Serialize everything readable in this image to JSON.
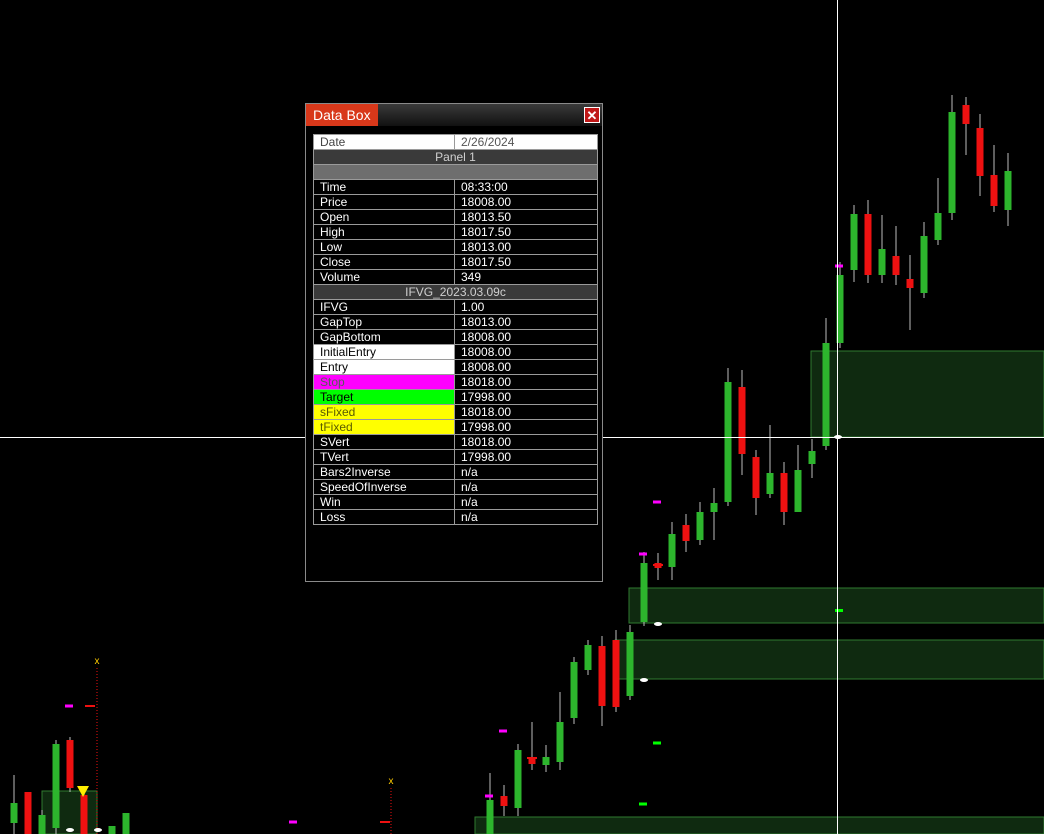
{
  "databox": {
    "title": "Data Box",
    "close_symbol": "✕",
    "date_label": "Date",
    "date_value": "2/26/2024",
    "panel_label": "Panel 1",
    "indicator_label": "IFVG_2023.03.09c",
    "rows_top": [
      {
        "label": "Time",
        "value": "08:33:00"
      },
      {
        "label": "Price",
        "value": "18008.00"
      },
      {
        "label": "Open",
        "value": "18013.50"
      },
      {
        "label": "High",
        "value": "18017.50"
      },
      {
        "label": "Low",
        "value": "18013.00"
      },
      {
        "label": "Close",
        "value": "18017.50"
      },
      {
        "label": "Volume",
        "value": "349"
      }
    ],
    "rows_indicator": [
      {
        "label": "IFVG",
        "value": "1.00",
        "bg": "#000000",
        "fg": "#ffffff"
      },
      {
        "label": "GapTop",
        "value": "18013.00",
        "bg": "#000000",
        "fg": "#ffffff"
      },
      {
        "label": "GapBottom",
        "value": "18008.00",
        "bg": "#000000",
        "fg": "#ffffff"
      },
      {
        "label": "InitialEntry",
        "value": "18008.00",
        "bg": "#ffffff",
        "fg": "#000000"
      },
      {
        "label": "Entry",
        "value": "18008.00",
        "bg": "#ffffff",
        "fg": "#000000"
      },
      {
        "label": "Stop",
        "value": "18018.00",
        "bg": "#ff00ff",
        "fg": "#5a5a5a"
      },
      {
        "label": "Target",
        "value": "17998.00",
        "bg": "#00ff00",
        "fg": "#000000"
      },
      {
        "label": "sFixed",
        "value": "18018.00",
        "bg": "#ffff00",
        "fg": "#5a5a00"
      },
      {
        "label": "tFixed",
        "value": "17998.00",
        "bg": "#ffff00",
        "fg": "#5a5a00"
      },
      {
        "label": "SVert",
        "value": "18018.00",
        "bg": "#000000",
        "fg": "#ffffff"
      },
      {
        "label": "TVert",
        "value": "17998.00",
        "bg": "#000000",
        "fg": "#ffffff"
      },
      {
        "label": "Bars2Inverse",
        "value": "n/a",
        "bg": "#000000",
        "fg": "#ffffff"
      },
      {
        "label": "SpeedOfInverse",
        "value": "n/a",
        "bg": "#000000",
        "fg": "#ffffff"
      },
      {
        "label": "Win",
        "value": "n/a",
        "bg": "#000000",
        "fg": "#ffffff"
      },
      {
        "label": "Loss",
        "value": "n/a",
        "bg": "#000000",
        "fg": "#ffffff"
      }
    ]
  },
  "chart": {
    "colors": {
      "background": "#000000",
      "up": "#2db52d",
      "down": "#ee1111",
      "wick": "#bdbdbd",
      "zone_fill": "#0f2a10",
      "zone_border": "#2f7a2f",
      "crosshair": "#ffffff",
      "stop_marker": "#ff00ff",
      "target_marker": "#00ff00",
      "signal_x": "#ffcc00"
    },
    "signal_label": "x"
  }
}
